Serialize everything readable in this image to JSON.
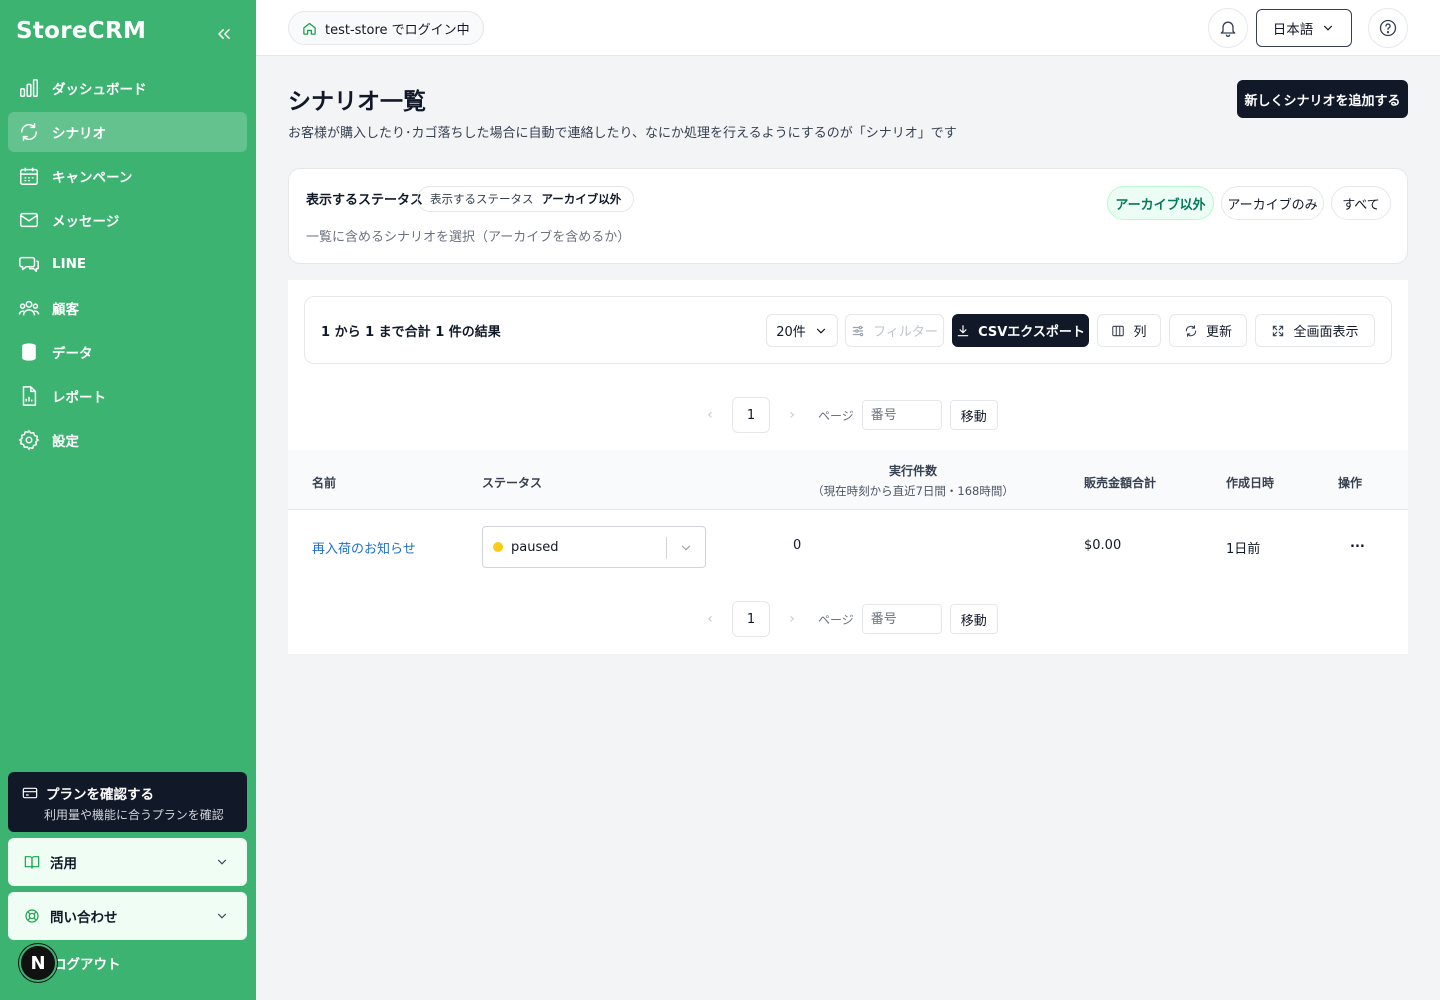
{
  "sidebar": {
    "logo": "StoreCRM",
    "items": [
      {
        "label": "ダッシュボード",
        "icon": "bar-chart-icon"
      },
      {
        "label": "シナリオ",
        "icon": "refresh-icon"
      },
      {
        "label": "キャンペーン",
        "icon": "calendar-icon"
      },
      {
        "label": "メッセージ",
        "icon": "mail-icon"
      },
      {
        "label": "LINE",
        "icon": "chat-icon"
      },
      {
        "label": "顧客",
        "icon": "users-icon"
      },
      {
        "label": "データ",
        "icon": "database-icon"
      },
      {
        "label": "レポート",
        "icon": "file-chart-icon"
      },
      {
        "label": "設定",
        "icon": "gear-icon"
      }
    ],
    "active_item": "シナリオ",
    "plan": {
      "title": "プランを確認する",
      "subtitle": "利用量や機能に合うプランを確認"
    },
    "utilize": "活用",
    "contact": "問い合わせ",
    "logout": "ログアウト",
    "avatar_letter": "N"
  },
  "topbar": {
    "store": "test-store でログイン中",
    "language": "日本語"
  },
  "page": {
    "title": "シナリオ一覧",
    "description": "お客様が購入したり･カゴ落ちした場合に自動で連絡したり、なにか処理を行えるようにするのが「シナリオ」です",
    "add_button": "新しくシナリオを追加する"
  },
  "status_filter": {
    "label": "表示するステータス",
    "chip_key": "表示するステータス",
    "chip_value": "アーカイブ以外",
    "help": "一覧に含めるシナリオを選択（アーカイブを含めるか）",
    "options": [
      "アーカイブ以外",
      "アーカイブのみ",
      "すべて"
    ],
    "selected": "アーカイブ以外"
  },
  "toolbar": {
    "result": "1 から 1 まで合計 1 件の結果",
    "page_size": "20件",
    "filter": "フィルター",
    "csv": "CSVエクスポート",
    "columns": "列",
    "refresh": "更新",
    "fullscreen": "全画面表示"
  },
  "pagination": {
    "current_page": "1",
    "page_label": "ページ",
    "input_placeholder": "番号",
    "go": "移動"
  },
  "table": {
    "headers": {
      "name": "名前",
      "status": "ステータス",
      "executions": "実行件数",
      "executions_sub": "（現在時刻から直近7日間・168時間）",
      "sales": "販売金額合計",
      "created": "作成日時",
      "actions": "操作"
    },
    "rows": [
      {
        "name": "再入荷のお知らせ",
        "status": "paused",
        "status_color": "#facc15",
        "executions": "0",
        "sales": "$0.00",
        "created": "1日前",
        "actions": "..."
      }
    ]
  },
  "colors": {
    "sidebar": "#3cb371",
    "primary_dark": "#111827",
    "link": "#1d6fc9",
    "active_segment": "#047857"
  }
}
